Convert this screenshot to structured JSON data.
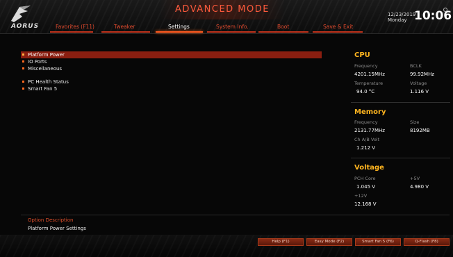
{
  "header": {
    "brand": "AORUS",
    "mode_title": "ADVANCED MODE",
    "date": "12/23/2019",
    "day": "Monday",
    "time": "10:06",
    "tabs": [
      {
        "label": "Favorites (F11)",
        "active": false
      },
      {
        "label": "Tweaker",
        "active": false
      },
      {
        "label": "Settings",
        "active": true
      },
      {
        "label": "System Info.",
        "active": false
      },
      {
        "label": "Boot",
        "active": false
      },
      {
        "label": "Save & Exit",
        "active": false
      }
    ]
  },
  "menu": {
    "items": [
      {
        "label": "Platform Power",
        "selected": true
      },
      {
        "label": "IO Ports",
        "selected": false
      },
      {
        "label": "Miscellaneous",
        "selected": false
      },
      {
        "label": "PC Health Status",
        "selected": false
      },
      {
        "label": "Smart Fan 5",
        "selected": false
      }
    ]
  },
  "cpu": {
    "title": "CPU",
    "frequency_label": "Frequency",
    "frequency": "4201.15MHz",
    "bclk_label": "BCLK",
    "bclk": "99.92MHz",
    "temperature_label": "Temperature",
    "temperature": "94.0 °C",
    "voltage_label": "Voltage",
    "voltage": "1.116 V"
  },
  "memory": {
    "title": "Memory",
    "frequency_label": "Frequency",
    "frequency": "2131.77MHz",
    "size_label": "Size",
    "size": "8192MB",
    "chab_label": "Ch A/B Volt",
    "chab": "1.212 V"
  },
  "voltage": {
    "title": "Voltage",
    "pch_label": "PCH Core",
    "pch": "1.045 V",
    "p5v_label": "+5V",
    "p5v": "4.980 V",
    "p12v_label": "+12V",
    "p12v": "12.168 V"
  },
  "description": {
    "title": "Option Description",
    "text": "Platform Power Settings"
  },
  "footer_buttons": [
    {
      "label": "Help (F1)"
    },
    {
      "label": "Easy Mode (F2)"
    },
    {
      "label": "Smart Fan 5 (F6)"
    },
    {
      "label": "Q-Flash (F8)"
    }
  ],
  "colors": {
    "accent": "#ff5a3c",
    "section_title": "#ffb51f",
    "selected_row": "#8a1e10"
  }
}
